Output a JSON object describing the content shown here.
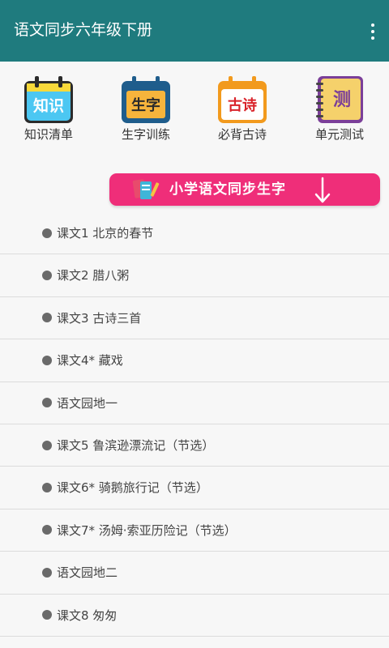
{
  "app_bar": {
    "title": "语文同步六年级下册",
    "menu_icon": "overflow-menu-icon"
  },
  "colors": {
    "app_bar": "#1f7b7e",
    "banner": "#ef2e79",
    "bullet": "#6a6a6a"
  },
  "tiles": [
    {
      "icon_text": "知识",
      "label": "知识清单",
      "icon": "calendar-knowledge-icon"
    },
    {
      "icon_text": "生字",
      "label": "生字训练",
      "icon": "calendar-characters-icon"
    },
    {
      "icon_text": "古诗",
      "label": "必背古诗",
      "icon": "calendar-poem-icon"
    },
    {
      "icon_text": "测",
      "label": "单元测试",
      "icon": "notebook-test-icon"
    }
  ],
  "banner": {
    "text": "小学语文同步生字",
    "icon": "books-pencil-icon",
    "arrow_icon": "arrow-down-icon"
  },
  "lessons": [
    "课文1 北京的春节",
    "课文2 腊八粥",
    "课文3 古诗三首",
    "课文4* 藏戏",
    "语文园地一",
    "课文5 鲁滨逊漂流记（节选）",
    "课文6* 骑鹅旅行记（节选）",
    "课文7* 汤姆·索亚历险记（节选）",
    "语文园地二",
    "课文8 匆匆"
  ]
}
